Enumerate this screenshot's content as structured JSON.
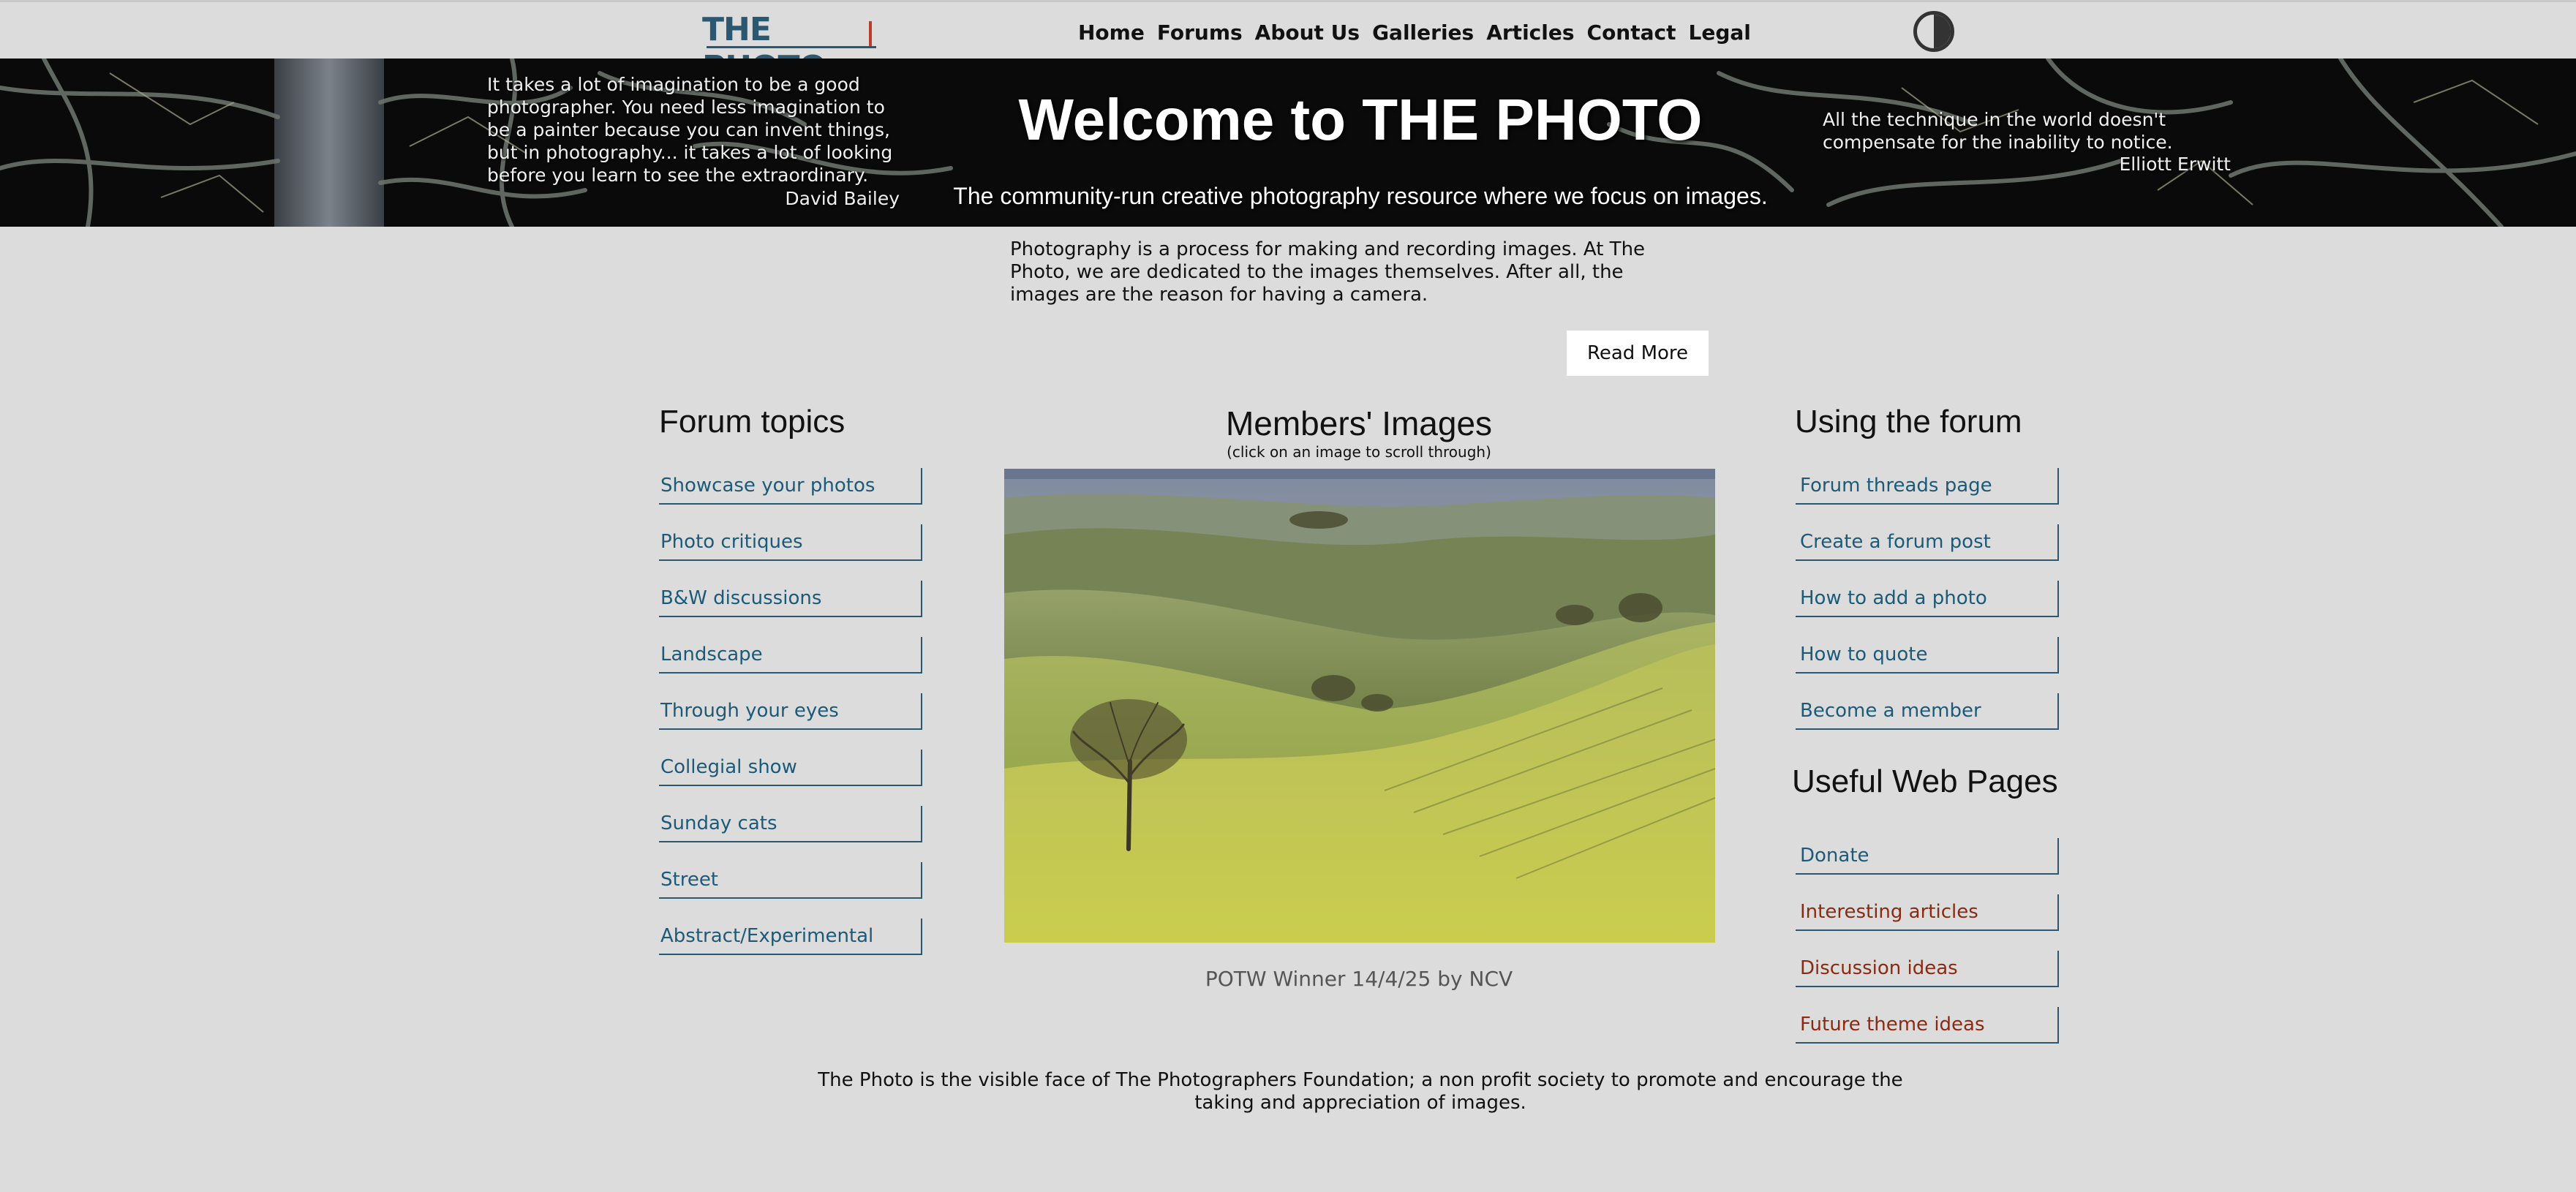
{
  "header": {
    "logo_text": "THE PHOTO",
    "nav": [
      "Home",
      "Forums",
      "About Us",
      "Galleries",
      "Articles",
      "Contact",
      "Legal"
    ]
  },
  "hero": {
    "title": "Welcome to THE PHOTO",
    "subtitle": "The community-run creative photography resource where we focus on images.",
    "quote_left": "It takes a lot of imagination to be a good photographer. You need less imagination to be a painter because you can invent things, but in photography... it takes a lot of looking before you learn to see the extraordinary.",
    "quote_left_author": "David Bailey",
    "quote_right": "All the technique in the world doesn't compensate for the inability to notice.",
    "quote_right_author": "Elliott Erwitt"
  },
  "intro": {
    "text": "Photography is a process for making and recording images. At The Photo, we are dedicated to the images themselves. After all, the images are the reason for having a camera.",
    "read_more": "Read More"
  },
  "forum_topics": {
    "heading": "Forum topics",
    "items": [
      "Showcase your photos",
      "Photo critiques",
      "B&W discussions",
      "Landscape",
      "Through your eyes",
      "Collegial show",
      "Sunday cats",
      "Street",
      "Abstract/Experimental"
    ]
  },
  "members": {
    "title": "Members' Images",
    "subtitle": "(click on an image to scroll through)",
    "caption": "POTW Winner 14/4/25 by NCV"
  },
  "using_forum": {
    "heading": "Using the forum",
    "items": [
      "Forum threads page",
      "Create a forum post",
      "How to add a photo",
      "How to quote",
      "Become a member"
    ]
  },
  "useful_pages": {
    "heading": "Useful Web Pages",
    "items": [
      "Donate",
      "Interesting articles",
      "Discussion ideas",
      "Future theme ideas"
    ]
  },
  "footer": {
    "text": "The Photo is the visible face of The Photographers Foundation; a non profit society to promote and encourage the taking and appreciation of images."
  },
  "colors": {
    "link_blue": "#1c5a78",
    "link_red": "#8b2a12",
    "logo": "#2c5770",
    "background": "#dcdcdc"
  },
  "icons": {
    "theme_toggle": "contrast-icon"
  }
}
